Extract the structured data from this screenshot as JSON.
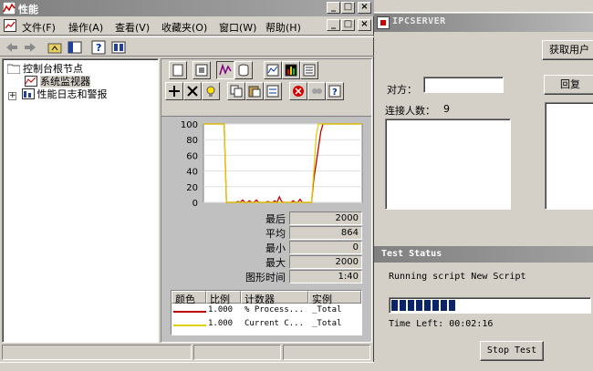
{
  "main_window": {
    "title": "性能",
    "menu": [
      "文件(F)",
      "操作(A)",
      "查看(V)",
      "收藏夹(O)",
      "窗口(W)",
      "帮助(H)"
    ],
    "caption_buttons": [
      "_",
      "□",
      "×"
    ]
  },
  "tree": {
    "root": "控制台根节点",
    "items": [
      "系统监视器",
      "性能日志和警报"
    ],
    "selected": "系统监视器"
  },
  "chart": {
    "y_ticks": [
      "100",
      "80",
      "60",
      "40",
      "20",
      "0"
    ]
  },
  "chart_data": {
    "type": "line",
    "ylim": [
      0,
      100
    ],
    "series": [
      {
        "color": "#c00000",
        "values": [
          100,
          100,
          100,
          100,
          100,
          100,
          100,
          100,
          100,
          100,
          0,
          0,
          0,
          0,
          0,
          1,
          0,
          3,
          0,
          0,
          2,
          0,
          0,
          3,
          0,
          0,
          0,
          0,
          1,
          0,
          0,
          2,
          0,
          7,
          1,
          0,
          0,
          0,
          0,
          2,
          0,
          0,
          4,
          0,
          0,
          0,
          0,
          0,
          30,
          50,
          70,
          90,
          100,
          100,
          100,
          100,
          100,
          100,
          100,
          100,
          100,
          100,
          100,
          100,
          100,
          100,
          100,
          100,
          100,
          100
        ]
      },
      {
        "color": "#e0d000",
        "values": [
          100,
          100,
          100,
          100,
          100,
          100,
          100,
          100,
          100,
          100,
          0,
          0,
          0,
          0,
          0,
          0,
          0,
          0,
          0,
          0,
          0,
          0,
          0,
          0,
          0,
          0,
          0,
          0,
          0,
          0,
          0,
          0,
          0,
          0,
          0,
          0,
          0,
          0,
          0,
          0,
          0,
          0,
          0,
          0,
          0,
          0,
          0,
          0,
          40,
          85,
          100,
          100,
          100,
          100,
          100,
          100,
          100,
          100,
          100,
          100,
          100,
          100,
          100,
          100,
          100,
          100,
          100,
          100,
          100,
          100
        ]
      }
    ]
  },
  "stats": [
    {
      "label": "最后",
      "value": "2000"
    },
    {
      "label": "平均",
      "value": "864"
    },
    {
      "label": "最小",
      "value": "0"
    },
    {
      "label": "最大",
      "value": "2000"
    },
    {
      "label": "图形时间",
      "value": "1:40"
    }
  ],
  "legend": {
    "headers": [
      "颜色",
      "比例",
      "计数器",
      "实例"
    ],
    "rows": [
      {
        "color": "#c00000",
        "scale": "1.000",
        "counter": "% Process...",
        "instance": "_Total"
      },
      {
        "color": "#e0d000",
        "scale": "1.000",
        "counter": "Current C...",
        "instance": "_Total"
      }
    ]
  },
  "ipc": {
    "title": "IPCSERVER",
    "get_user_btn": "获取用户",
    "reply_btn": "回复",
    "peer_label": "对方：",
    "count_label": "连接人数：",
    "count_value": "9"
  },
  "test_status": {
    "title": "Test Status",
    "running": "Running script New Script",
    "progress_blocks": 8,
    "time_left": "Time Left:  00:02:16",
    "stop_btn": "Stop Test"
  }
}
